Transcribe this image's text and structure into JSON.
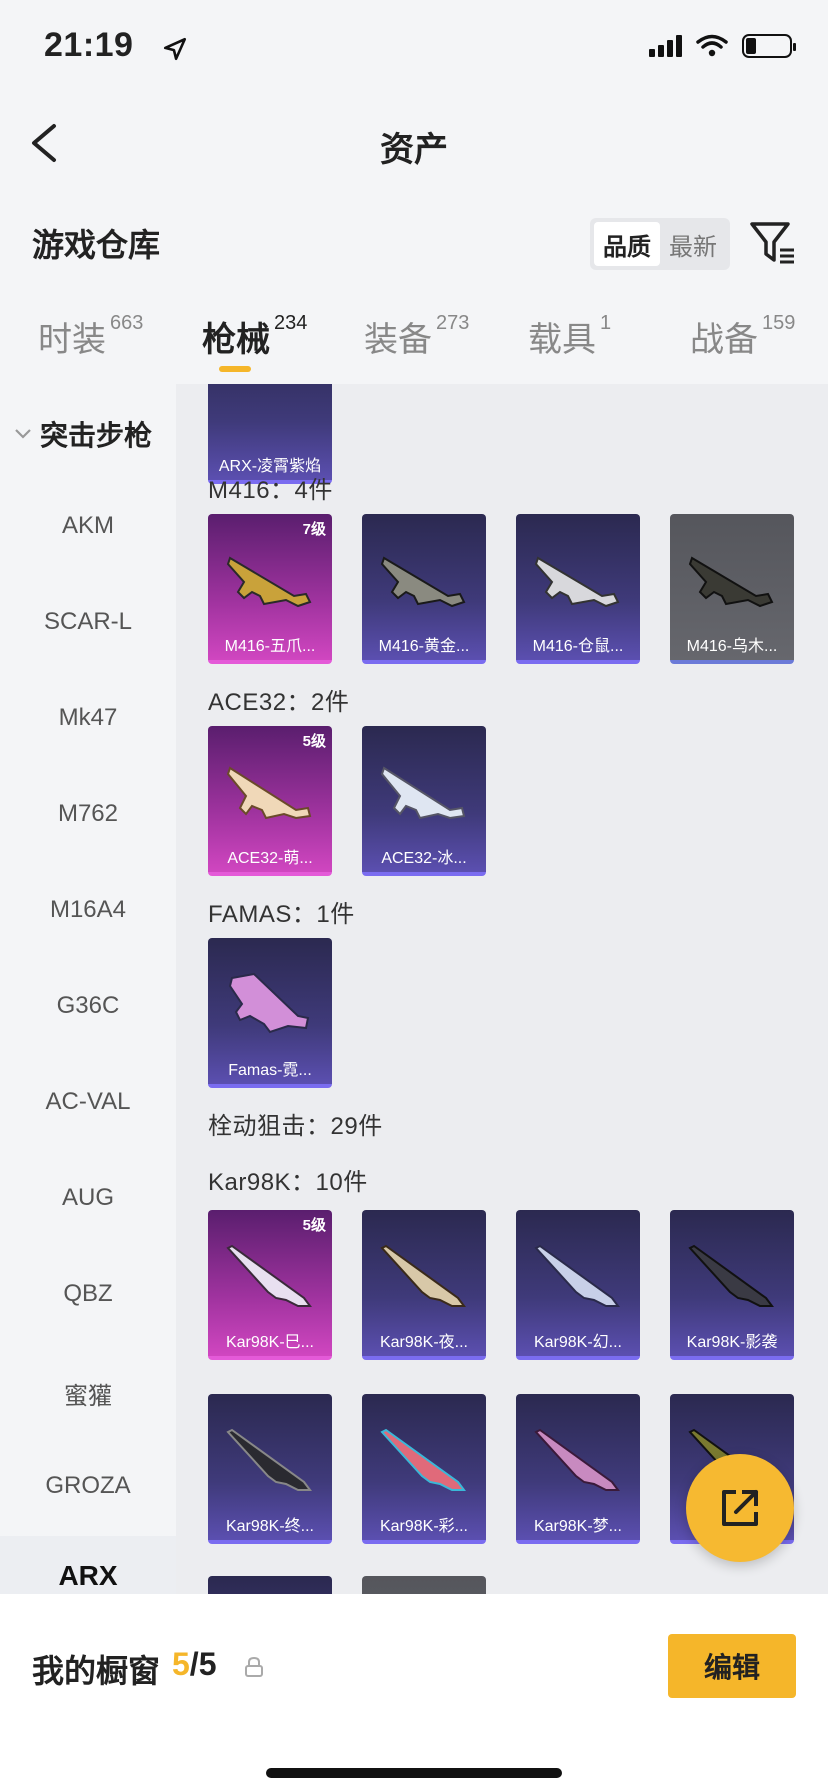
{
  "status_bar": {
    "time": "21:19"
  },
  "nav": {
    "title": "资产"
  },
  "warehouse": {
    "title": "游戏仓库",
    "sort_options": [
      "品质",
      "最新"
    ]
  },
  "tabs": [
    {
      "label": "时装",
      "count": "663"
    },
    {
      "label": "枪械",
      "count": "234"
    },
    {
      "label": "装备",
      "count": "273"
    },
    {
      "label": "载具",
      "count": "1"
    },
    {
      "label": "战备",
      "count": "159"
    }
  ],
  "sidenav": {
    "group": "突击步枪",
    "items": [
      "AKM",
      "SCAR-L",
      "Mk47",
      "M762",
      "M16A4",
      "G36C",
      "AC-VAL",
      "AUG",
      "QBZ",
      "蜜獾",
      "GROZA",
      "ARX"
    ]
  },
  "content": {
    "top_card": {
      "name": "ARX-凌霄紫焰"
    },
    "sections": {
      "m416": "M416：4件",
      "ace32": "ACE32：2件",
      "famas": "FAMAS：1件",
      "bolt": "栓动狙击：29件",
      "kar98k": "Kar98K：10件"
    },
    "cards": {
      "m416": [
        {
          "name": "M416-五爪...",
          "level": "7级"
        },
        {
          "name": "M416-黄金..."
        },
        {
          "name": "M416-仓鼠..."
        },
        {
          "name": "M416-乌木..."
        }
      ],
      "ace32": [
        {
          "name": "ACE32-萌...",
          "level": "5级"
        },
        {
          "name": "ACE32-冰..."
        }
      ],
      "famas": [
        {
          "name": "Famas-霓..."
        }
      ],
      "kar98k_row1": [
        {
          "name": "Kar98K-巳...",
          "level": "5级"
        },
        {
          "name": "Kar98K-夜..."
        },
        {
          "name": "Kar98K-幻..."
        },
        {
          "name": "Kar98K-影袭"
        }
      ],
      "kar98k_row2": [
        {
          "name": "Kar98K-终..."
        },
        {
          "name": "Kar98K-彩..."
        },
        {
          "name": "Kar98K-梦..."
        },
        {
          "name": ""
        }
      ]
    }
  },
  "bottom_bar": {
    "showcase_label": "我的橱窗",
    "showcase_current": "5",
    "showcase_total": "/5",
    "edit_label": "编辑"
  },
  "colors": {
    "accent": "#f5b62a",
    "rare_purple": "#5b4fb0",
    "legendary_pink": "#d046c0"
  }
}
